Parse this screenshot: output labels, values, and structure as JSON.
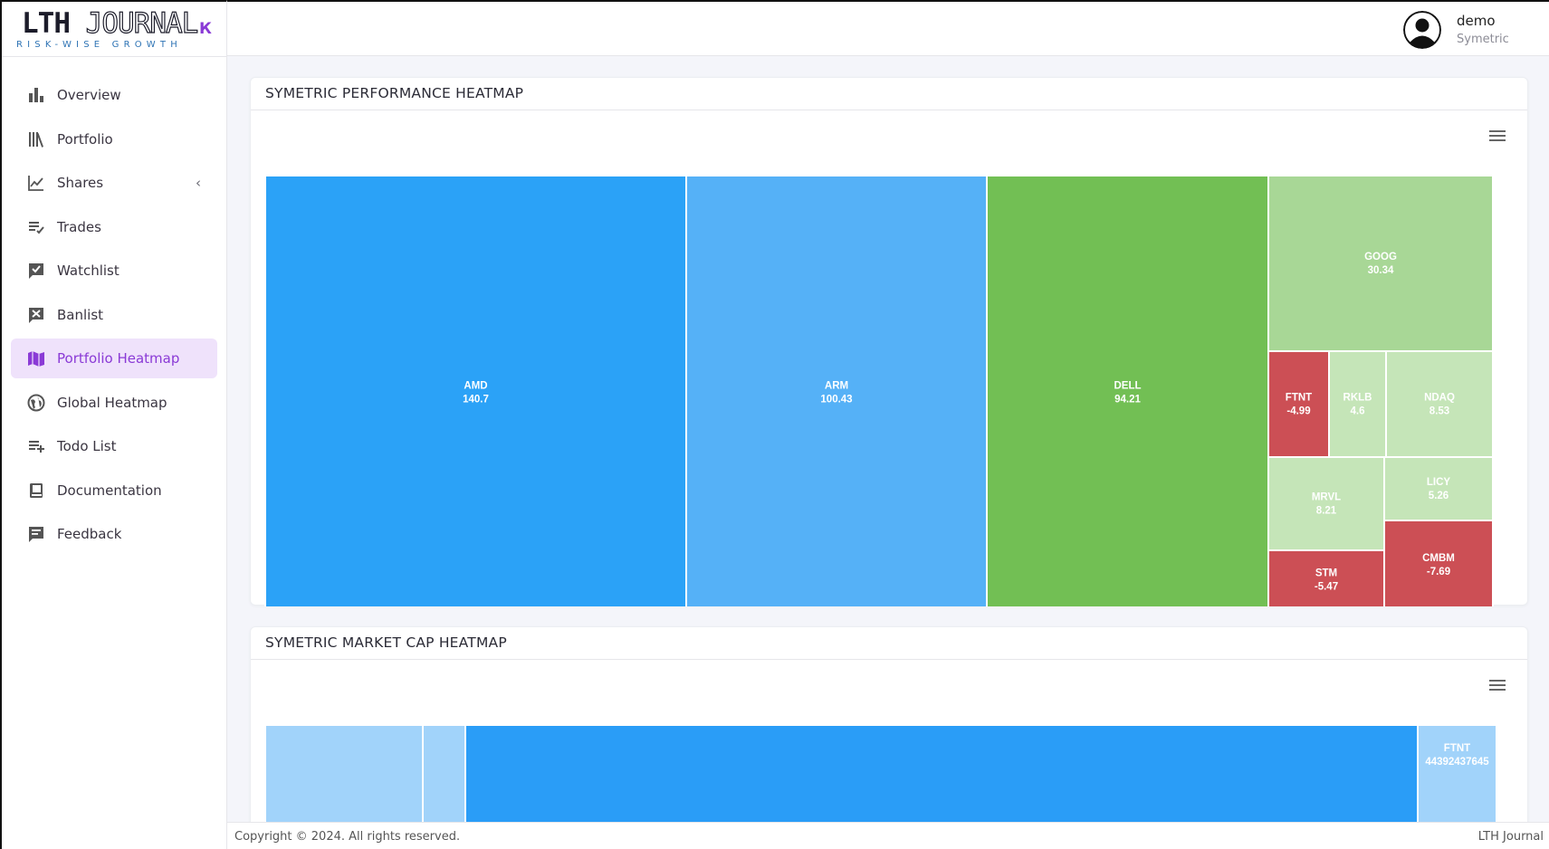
{
  "brand": {
    "logo_bold": "LTH",
    "logo_outline": "JOURNAL",
    "tagline": "RISK-WISE GROWTH",
    "collapse_glyph": "ₖ"
  },
  "sidebar": {
    "items": [
      {
        "label": "Overview",
        "icon": "bar-chart-icon"
      },
      {
        "label": "Portfolio",
        "icon": "library-icon"
      },
      {
        "label": "Shares",
        "icon": "line-chart-icon",
        "has_submenu": true
      },
      {
        "label": "Trades",
        "icon": "list-edit-icon"
      },
      {
        "label": "Watchlist",
        "icon": "checkbox-icon"
      },
      {
        "label": "Banlist",
        "icon": "x-box-icon"
      },
      {
        "label": "Portfolio Heatmap",
        "icon": "map-icon",
        "active": true
      },
      {
        "label": "Global Heatmap",
        "icon": "globe-icon"
      },
      {
        "label": "Todo List",
        "icon": "playlist-add-icon"
      },
      {
        "label": "Documentation",
        "icon": "book-icon"
      },
      {
        "label": "Feedback",
        "icon": "message-icon"
      }
    ],
    "accent": "#8a3ad6",
    "active_bg": "#efe2fb"
  },
  "header": {
    "user_name": "demo",
    "user_role": "Symetric"
  },
  "performance": {
    "title": "SYMETRIC PERFORMANCE HEATMAP"
  },
  "marketcap": {
    "title": "SYMETRIC MARKET CAP HEATMAP"
  },
  "chart_data": [
    {
      "type": "heatmap",
      "title": "SYMETRIC PERFORMANCE HEATMAP",
      "items": [
        {
          "name": "AMD",
          "value": 140.7,
          "color": "#2ba2f7"
        },
        {
          "name": "ARM",
          "value": 100.43,
          "color": "#55b1f7"
        },
        {
          "name": "DELL",
          "value": 94.21,
          "color": "#72bf54"
        },
        {
          "name": "GOOG",
          "value": 30.34,
          "color": "#a8d796"
        },
        {
          "name": "FTNT",
          "value": -4.99,
          "color": "#cc4f55"
        },
        {
          "name": "RKLB",
          "value": 4.6,
          "color": "#c5e5b8"
        },
        {
          "name": "NDAQ",
          "value": 8.53,
          "color": "#c5e5b8"
        },
        {
          "name": "MRVL",
          "value": 8.21,
          "color": "#c5e5b8"
        },
        {
          "name": "LICY",
          "value": 5.26,
          "color": "#c5e5b8"
        },
        {
          "name": "STM",
          "value": -5.47,
          "color": "#cc4f55"
        },
        {
          "name": "CMBM",
          "value": -7.69,
          "color": "#cc4f55"
        }
      ]
    },
    {
      "type": "heatmap",
      "title": "SYMETRIC MARKET CAP HEATMAP",
      "items": [
        {
          "name": "",
          "value": null,
          "color": "#a1d3fa"
        },
        {
          "name": "",
          "value": null,
          "color": "#a1d3fa"
        },
        {
          "name": "",
          "value": null,
          "color": "#2a9df7"
        },
        {
          "name": "FTNT",
          "value": 44392437645,
          "color": "#a1d3fa"
        }
      ]
    }
  ],
  "footer": {
    "copyright": "Copyright © 2024. All rights reserved.",
    "brand": "LTH Journal"
  }
}
